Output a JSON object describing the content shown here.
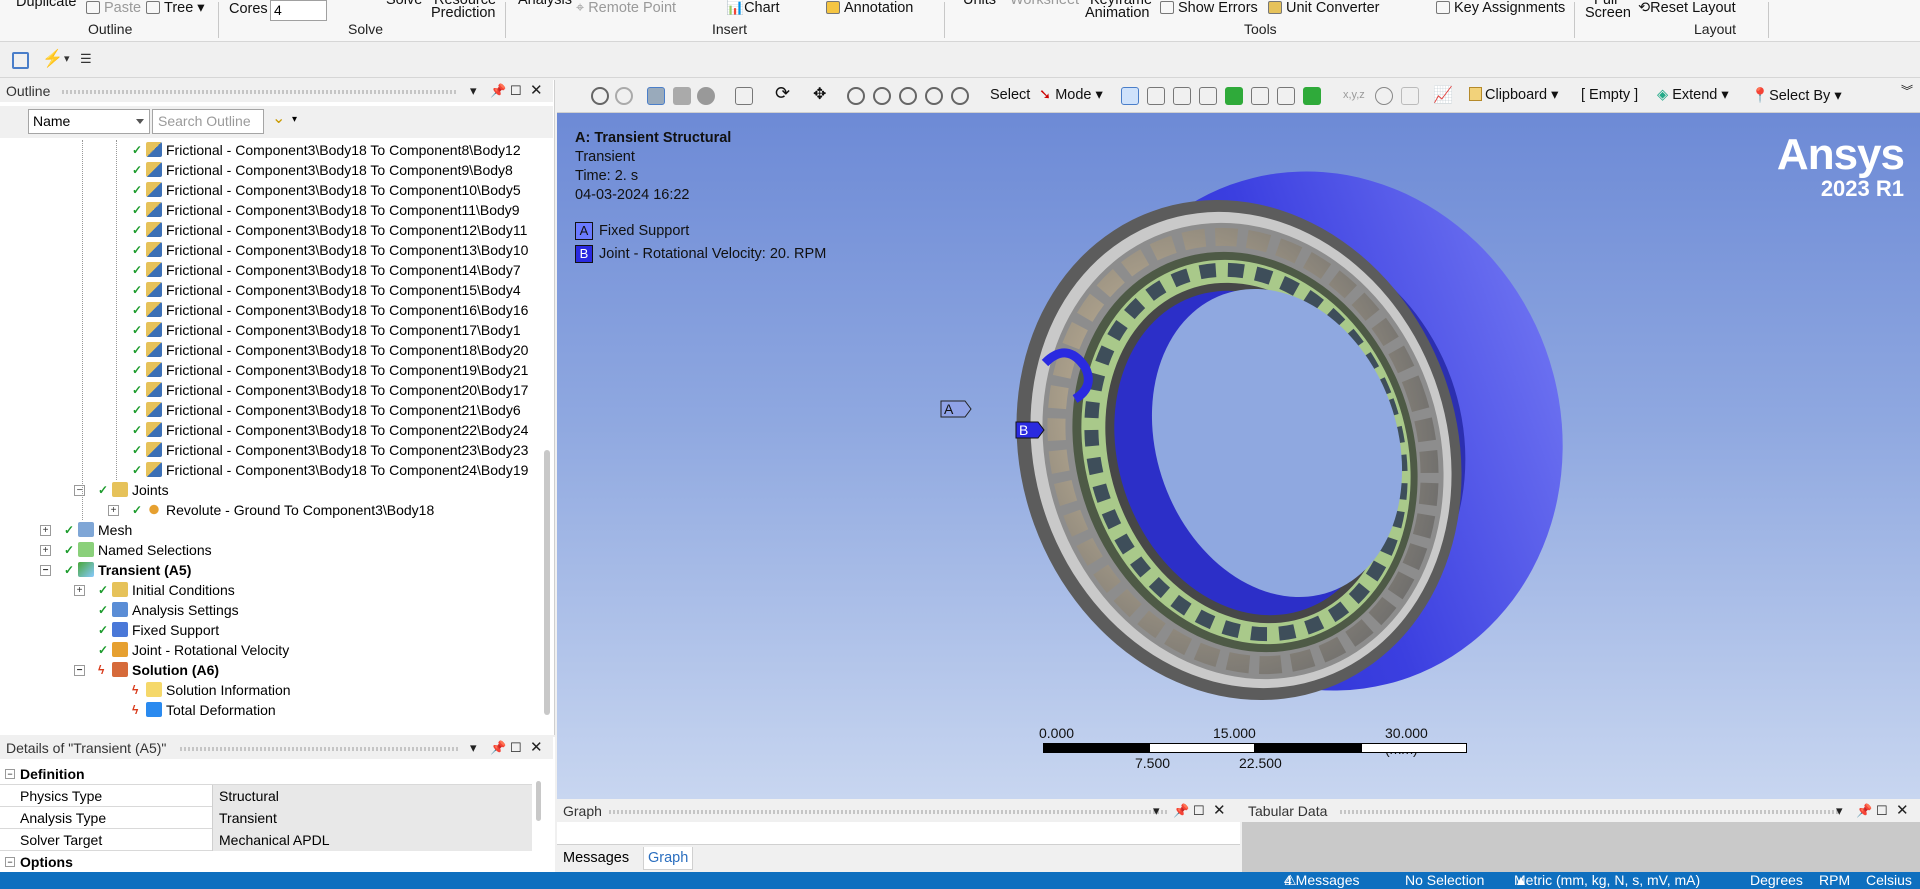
{
  "ribbon": {
    "duplicate": "Duplicate",
    "paste": "Paste",
    "tree": "Tree",
    "outline_group": "Outline",
    "cores_label": "Cores",
    "cores_value": "4",
    "solve": "Solve",
    "resource_prediction_1": "Resource",
    "resource_prediction_2": "Prediction",
    "solve_group": "Solve",
    "analysis": "Analysis",
    "remote_point": "Remote Point",
    "chart": "Chart",
    "annotation": "Annotation",
    "insert_group": "Insert",
    "units": "Units",
    "worksheet": "Worksheet",
    "keyframe_1": "Keyframe",
    "keyframe_2": "Animation",
    "show_errors": "Show Errors",
    "unit_converter": "Unit Converter",
    "key_assignments": "Key Assignments",
    "tools_group": "Tools",
    "full_1": "Full",
    "full_2": "Screen",
    "reset_layout": "Reset Layout",
    "layout_group": "Layout"
  },
  "outline": {
    "title": "Outline",
    "name_filter": "Name",
    "search_placeholder": "Search Outline",
    "contacts": [
      "Frictional - Component3\\Body18 To Component8\\Body12",
      "Frictional - Component3\\Body18 To Component9\\Body8",
      "Frictional - Component3\\Body18 To Component10\\Body5",
      "Frictional - Component3\\Body18 To Component11\\Body9",
      "Frictional - Component3\\Body18 To Component12\\Body11",
      "Frictional - Component3\\Body18 To Component13\\Body10",
      "Frictional - Component3\\Body18 To Component14\\Body7",
      "Frictional - Component3\\Body18 To Component15\\Body4",
      "Frictional - Component3\\Body18 To Component16\\Body16",
      "Frictional - Component3\\Body18 To Component17\\Body1",
      "Frictional - Component3\\Body18 To Component18\\Body20",
      "Frictional - Component3\\Body18 To Component19\\Body21",
      "Frictional - Component3\\Body18 To Component20\\Body17",
      "Frictional - Component3\\Body18 To Component21\\Body6",
      "Frictional - Component3\\Body18 To Component22\\Body24",
      "Frictional - Component3\\Body18 To Component23\\Body23",
      "Frictional - Component3\\Body18 To Component24\\Body19"
    ],
    "joints": "Joints",
    "revolute": "Revolute - Ground To Component3\\Body18",
    "mesh": "Mesh",
    "named_selections": "Named Selections",
    "transient": "Transient (A5)",
    "initial_conditions": "Initial Conditions",
    "analysis_settings": "Analysis Settings",
    "fixed_support": "Fixed Support",
    "joint_rot_vel": "Joint - Rotational Velocity",
    "solution": "Solution (A6)",
    "solution_info": "Solution Information",
    "total_deformation": "Total Deformation"
  },
  "details": {
    "title": "Details of \"Transient (A5)\"",
    "definition": "Definition",
    "rows": [
      {
        "k": "Physics Type",
        "v": "Structural"
      },
      {
        "k": "Analysis Type",
        "v": "Transient"
      },
      {
        "k": "Solver Target",
        "v": "Mechanical APDL"
      }
    ],
    "options": "Options"
  },
  "viewport_toolbar": {
    "select": "Select",
    "mode": "Mode",
    "clipboard": "Clipboard",
    "empty": "[ Empty ]",
    "extend": "Extend",
    "select_by": "Select By"
  },
  "viewport": {
    "title": "A: Transient Structural",
    "type": "Transient",
    "time": "Time: 2. s",
    "date": "04-03-2024 16:22",
    "legend_a_key": "A",
    "legend_a": "Fixed Support",
    "legend_b_key": "B",
    "legend_b": "Joint - Rotational Velocity: 20. RPM",
    "logo": "Ansys",
    "release": "2023 R1",
    "tag_a": "A",
    "tag_b": "B",
    "scale": {
      "t0": "0.000",
      "t15": "15.000",
      "t30": "30.000 (mm)",
      "b75": "7.500",
      "b225": "22.500"
    }
  },
  "graph": {
    "title": "Graph",
    "tab_messages": "Messages",
    "tab_graph": "Graph"
  },
  "tabular": {
    "title": "Tabular Data"
  },
  "status": {
    "messages": "4 Messages",
    "selection": "No Selection",
    "units": "Metric (mm, kg, N, s, mV, mA)",
    "angle": "Degrees",
    "rpm": "RPM",
    "temp": "Celsius"
  },
  "colors": {
    "accent": "#0e6fbf",
    "ring_blue": "#3b3fe0",
    "cage_green": "#a9c98a"
  }
}
